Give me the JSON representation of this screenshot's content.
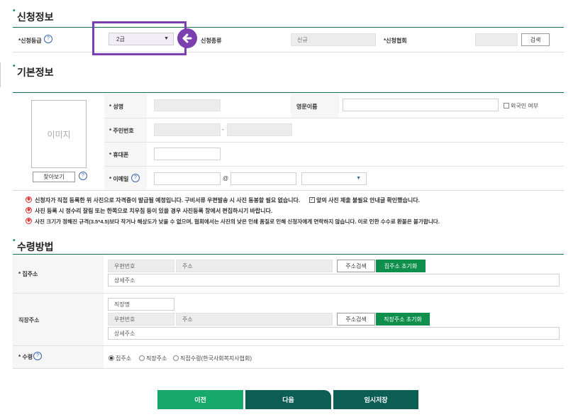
{
  "apply_info": {
    "title": "신청정보",
    "grade_label": "*신청등급",
    "grade_value": "2급",
    "type_label": "신청종류",
    "type_value": "신규",
    "assoc_label": "*신청협회",
    "search_label": "검색"
  },
  "basic_info": {
    "title": "기본정보",
    "photo_placeholder": "이미지",
    "find_button": "찾아보기",
    "name_label": "* 성명",
    "eng_name_label": "영문이름",
    "foreigner_label": "외국인 여부",
    "rrn_label": "* 주민번호",
    "rrn_sep": "-",
    "phone_label": "* 휴대폰",
    "email_label": "* 이메일",
    "email_at": "@"
  },
  "notes": [
    "신청자가 직접 등록한 위 사진으로 자격증이 발급될 예정입니다. 구비서류 우편발송 시 사진 동봉할 필요 없습니다.",
    "사진 등록 시 정수리 잘림 또는 한쪽으로 치우침 등이 있을 경우 사진등록 창에서 편집하시기 바랍니다.",
    "사진 크기가 정해진 규격(3.5*4.5)보다 작거나 해상도가 낮을 수 없으며, 협회에서는 사진의 낮은 인쇄 품질로 인해 신청자에게 연락하지 않습니다. 이로 인한 수수료 환불은 불가합니다."
  ],
  "confirm_note": "앞의 사진 제출 불필요 안내글 확인했습니다.",
  "receive": {
    "title": "수령방법",
    "home_label": "* 집주소",
    "zip_placeholder": "우편번호",
    "addr_placeholder": "주소",
    "detail_placeholder": "상세주소",
    "addr_search": "주소검색",
    "home_reset": "집주소 초기화",
    "work_label": "직장주소",
    "company_placeholder": "직장명",
    "work_reset": "직장주소 초기화",
    "recv_label": "* 수령",
    "opt_home": "집주소",
    "opt_work": "직장주소",
    "opt_visit": "직접수령(한국사회복지사협회)"
  },
  "actions": {
    "prev": "이전",
    "next": "다음",
    "temp_save": "임시저장"
  },
  "colors": {
    "accent_green": "#0e8f4c",
    "highlight_purple": "#7b3fb0",
    "dark_teal": "#0d5e55"
  }
}
